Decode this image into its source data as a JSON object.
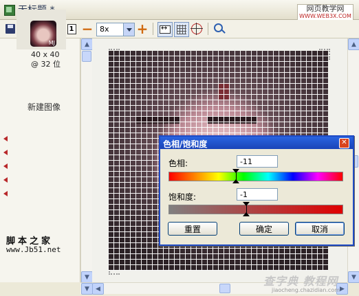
{
  "window": {
    "title": "无标题 *",
    "site_watermark": "网页教学网",
    "site_watermark_url": "WWW.WEB3X.COM"
  },
  "toolbar": {
    "zoom_value": "8x",
    "items": [
      "save-icon",
      "new-file-icon",
      "delete-icon",
      "actual-size-icon",
      "zoom-out-icon",
      "zoom-select",
      "zoom-in-icon",
      "fit-width-icon",
      "grid-icon",
      "crosshair-icon",
      "magnifier-icon"
    ]
  },
  "left_panel": {
    "thumb_label": "MJ",
    "size": "40 x 40",
    "depth": "@ 32 位",
    "new_image": "新建图像",
    "footer_title": "脚本之家",
    "footer_url": "www.Jb51.net"
  },
  "dialog": {
    "title": "色相/饱和度",
    "hue_label": "色相:",
    "hue_value": "-11",
    "hue_marker_fraction": 0.39,
    "saturation_label": "饱和度:",
    "saturation_value": "-1",
    "saturation_marker_fraction": 0.45,
    "reset_label": "重置",
    "ok_label": "确定",
    "cancel_label": "取消"
  },
  "bottom": {
    "watermark": "查字典 教程网",
    "watermark_sub": "jiaocheng.chazidian.com"
  },
  "colors": {
    "dialog_title": "#1A44B8",
    "close_button": "#D9431E",
    "accent_orange": "#D06A10",
    "delete_red": "#C42020"
  }
}
